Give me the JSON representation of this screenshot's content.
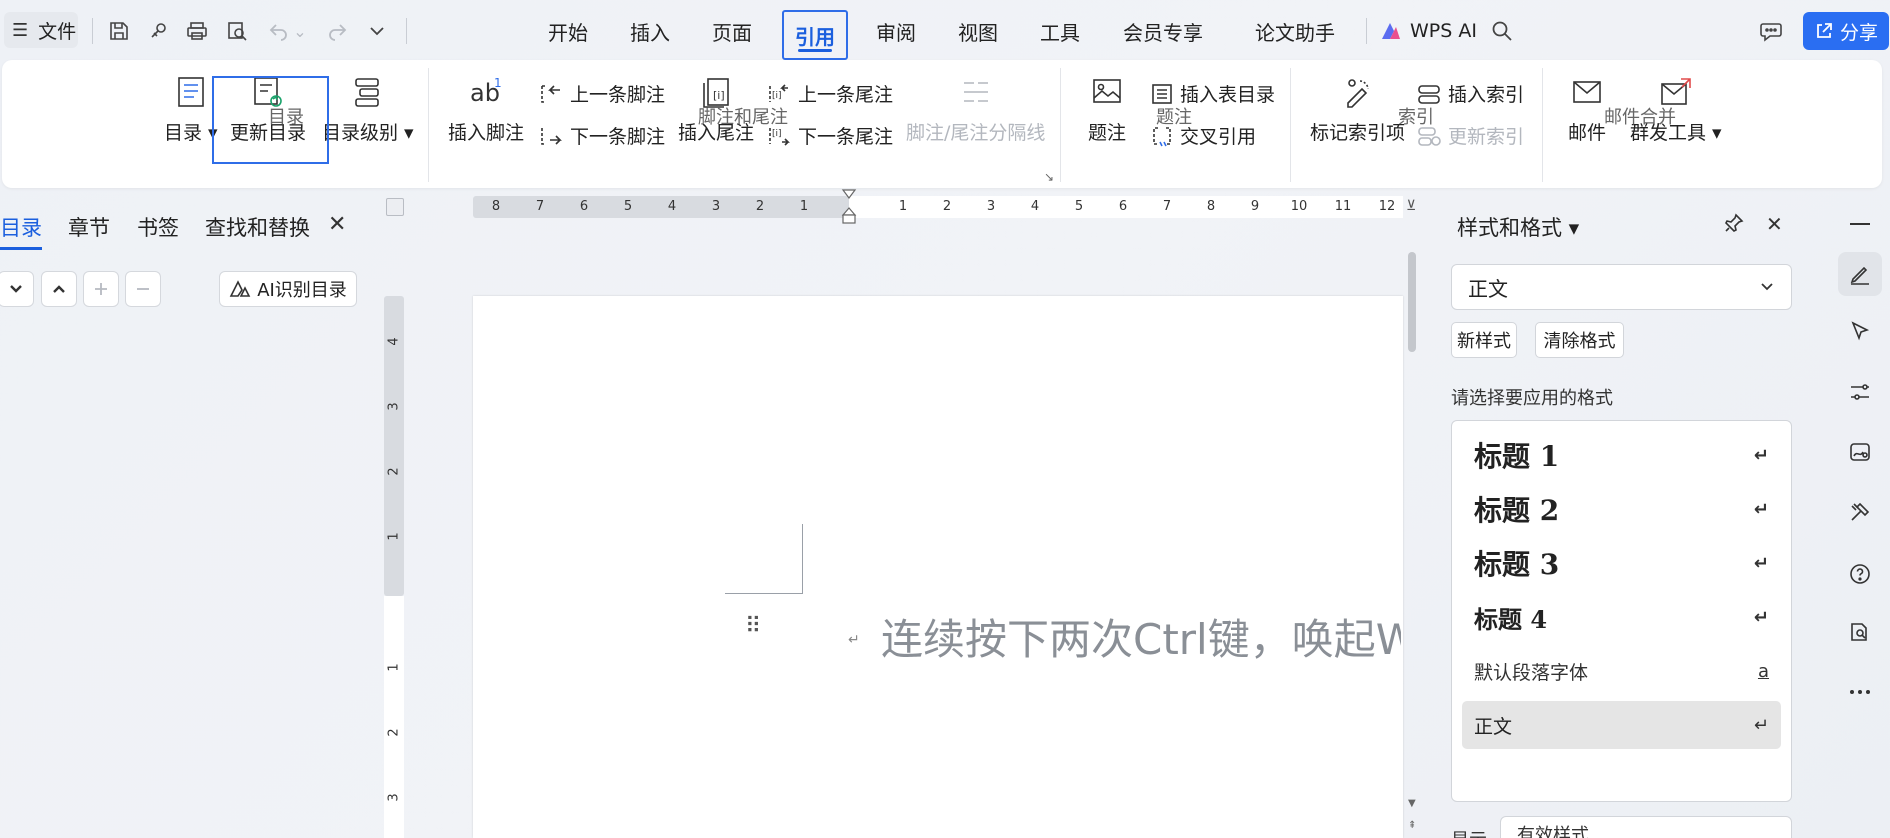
{
  "titlebar": {
    "file_label": "文件",
    "menu_tabs": [
      "开始",
      "插入",
      "页面",
      "引用",
      "审阅",
      "视图",
      "工具",
      "会员专享",
      "论文助手"
    ],
    "active_tab": "引用",
    "wps_ai_label": "WPS AI",
    "share_label": "分享"
  },
  "ribbon": {
    "toc_label": "目录",
    "update_toc_label": "更新目录",
    "toc_level_label": "目录级别",
    "group_toc": "目录",
    "insert_footnote_label": "插入脚注",
    "prev_footnote_label": "上一条脚注",
    "next_footnote_label": "下一条脚注",
    "insert_endnote_label": "插入尾注",
    "prev_endnote_label": "上一条尾注",
    "next_endnote_label": "下一条尾注",
    "separator_label": "脚注/尾注分隔线",
    "group_footnote": "脚注和尾注",
    "caption_label": "题注",
    "insert_table_of_figures_label": "插入表目录",
    "cross_ref_label": "交叉引用",
    "group_caption": "题注",
    "mark_index_label": "标记索引项",
    "insert_index_label": "插入索引",
    "update_index_label": "更新索引",
    "group_index": "索引",
    "mail_label": "邮件",
    "mass_send_label": "群发工具",
    "group_mail": "邮件合并"
  },
  "left_pane": {
    "tabs": [
      "目录",
      "章节",
      "书签",
      "查找和替换"
    ],
    "active_tab": "目录",
    "ai_toc_label": "AI识别目录"
  },
  "ruler": {
    "h_left": [
      "8",
      "7",
      "6",
      "5",
      "4",
      "3",
      "2",
      "1"
    ],
    "h_right": [
      "1",
      "2",
      "3",
      "4",
      "5",
      "6",
      "7",
      "8",
      "9",
      "10",
      "11",
      "12"
    ],
    "v_top": [
      "4",
      "3",
      "2",
      "1"
    ],
    "v_bottom": [
      "1",
      "2",
      "3"
    ]
  },
  "document": {
    "hint_text": "连续按下两次Ctrl键，唤起W"
  },
  "styles_panel": {
    "title": "样式和格式",
    "current_style": "正文",
    "new_style_label": "新样式",
    "clear_format_label": "清除格式",
    "hint": "请选择要应用的格式",
    "items": [
      {
        "name": "标题  1",
        "mark": "↵"
      },
      {
        "name": "标题  2",
        "mark": "↵"
      },
      {
        "name": "标题  3",
        "mark": "↵"
      },
      {
        "name": "标题  4",
        "mark": "↵"
      },
      {
        "name": "默认段落字体",
        "mark": "a"
      },
      {
        "name": "正文",
        "mark": "↵"
      }
    ],
    "show_label": "显示",
    "show_value": "有效样式"
  },
  "colors": {
    "accent": "#2a6ef2",
    "active_text": "#1b5fde"
  }
}
